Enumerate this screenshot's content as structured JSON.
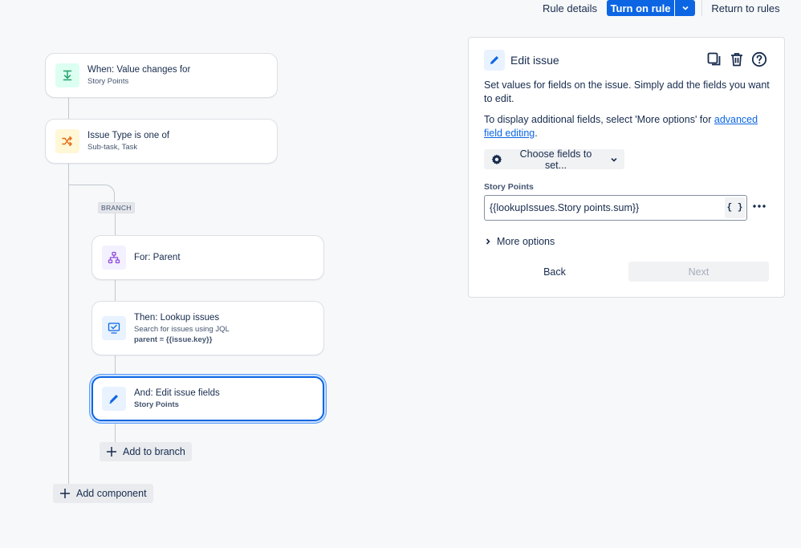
{
  "header": {
    "rule_details": "Rule details",
    "turn_on_rule": "Turn on rule",
    "return_to_rules": "Return to rules"
  },
  "flow": {
    "trigger": {
      "title": "When: Value changes for",
      "subtitle": "Story Points",
      "icon": "value-changes-icon",
      "color": "#22a06b"
    },
    "condition": {
      "title": "Issue Type is one of",
      "subtitle": "Sub-task, Task",
      "icon": "shuffle-icon",
      "color": "#e56910"
    },
    "branch_label": "BRANCH",
    "branch": {
      "title": "For: Parent",
      "icon": "hierarchy-icon",
      "color": "#8f48d9"
    },
    "lookup": {
      "title": "Then: Lookup issues",
      "subtitle": "Search for issues using JQL",
      "detail": "parent = {{issue.key}}",
      "icon": "lookup-icon",
      "color": "#0c66e4"
    },
    "edit": {
      "title": "And: Edit issue fields",
      "subtitle": "Story Points",
      "icon": "pencil-icon",
      "color": "#0c66e4"
    },
    "add_to_branch": "Add to branch",
    "add_component": "Add component"
  },
  "panel": {
    "title": "Edit issue",
    "description": "Set values for fields on the issue. Simply add the fields you want to edit.",
    "display_prefix": "To display additional fields, select 'More options' for ",
    "display_link": "advanced field editing",
    "display_suffix": ".",
    "choose_fields": "Choose fields to set...",
    "field_label": "Story Points",
    "field_value": "{{lookupIssues.Story points.sum}}",
    "smart_value_button": "{ }",
    "more_options": "More options",
    "back": "Back",
    "next": "Next"
  },
  "colors": {
    "primary": "#0c66e4",
    "text": "#172b4d",
    "subtle_text": "#44546f",
    "background": "#f7f8f9"
  }
}
